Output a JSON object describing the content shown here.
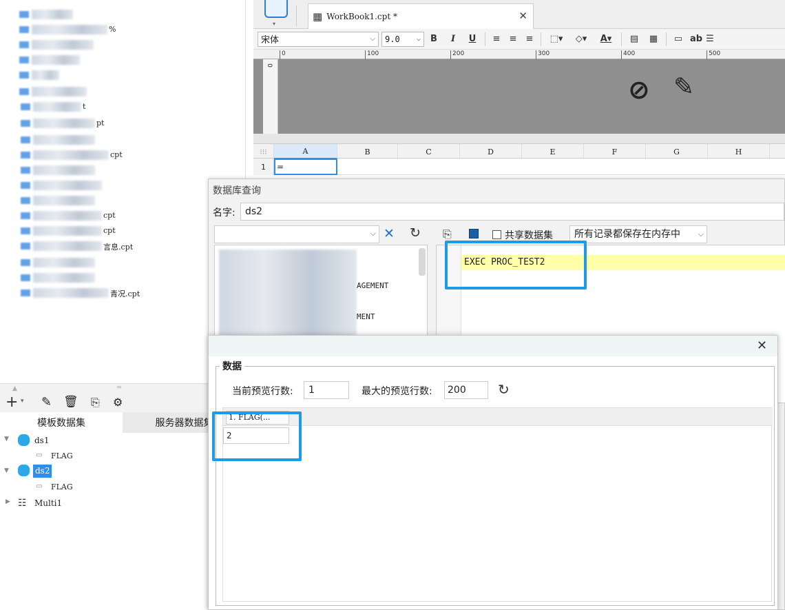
{
  "left_tree": {
    "rows": [
      {
        "suffix": ""
      },
      {
        "suffix": "%"
      },
      {
        "suffix": ""
      },
      {
        "suffix": ""
      },
      {
        "suffix": ""
      },
      {
        "suffix": ""
      },
      {
        "suffix": "t"
      },
      {
        "suffix": "pt"
      },
      {
        "suffix": ""
      },
      {
        "suffix": "cpt"
      },
      {
        "suffix": ""
      },
      {
        "suffix": ""
      },
      {
        "suffix": ""
      },
      {
        "suffix": "cpt"
      },
      {
        "suffix": "cpt"
      },
      {
        "suffix": "言息.cpt"
      },
      {
        "suffix": ""
      },
      {
        "suffix": ""
      },
      {
        "suffix": "青况.cpt"
      }
    ]
  },
  "editor": {
    "tab_title": "WorkBook1.cpt *",
    "font_name": "宋体",
    "font_size": "9.0",
    "bold": "B",
    "italic": "I",
    "underline": "U",
    "ab_label": "ab",
    "ruler_marks": [
      "0",
      "100",
      "200",
      "300",
      "400",
      "500"
    ],
    "columns": [
      "A",
      "B",
      "C",
      "D",
      "E",
      "F",
      "G",
      "H"
    ],
    "row_number": "1",
    "cell_a1": "="
  },
  "datasets": {
    "tabs": [
      "模板数据集",
      "服务器数据集"
    ],
    "tree": [
      {
        "name": "ds1",
        "field": "FLAG"
      },
      {
        "name": "ds2",
        "field": "FLAG"
      },
      {
        "name": "Multi1",
        "field": ""
      }
    ]
  },
  "query_dialog": {
    "title": "数据库查询",
    "name_label": "名字:",
    "name_value": "ds2",
    "share_label": "共享数据集",
    "storage_option": "所有记录都保存在内存中",
    "sql": "EXEC PROC_TEST2",
    "table_fragments": [
      "AGEMENT",
      "MENT"
    ]
  },
  "preview_dialog": {
    "group_label": "数据",
    "current_rows_label": "当前预览行数:",
    "current_rows_value": "1",
    "max_rows_label": "最大的预览行数:",
    "max_rows_value": "200",
    "column_header": "1. FLAG(...",
    "cell_value": "2"
  },
  "colors": {
    "highlight": "#1e9be8",
    "selection": "#2f8fe8",
    "sql_bg": "#ffffaa"
  }
}
